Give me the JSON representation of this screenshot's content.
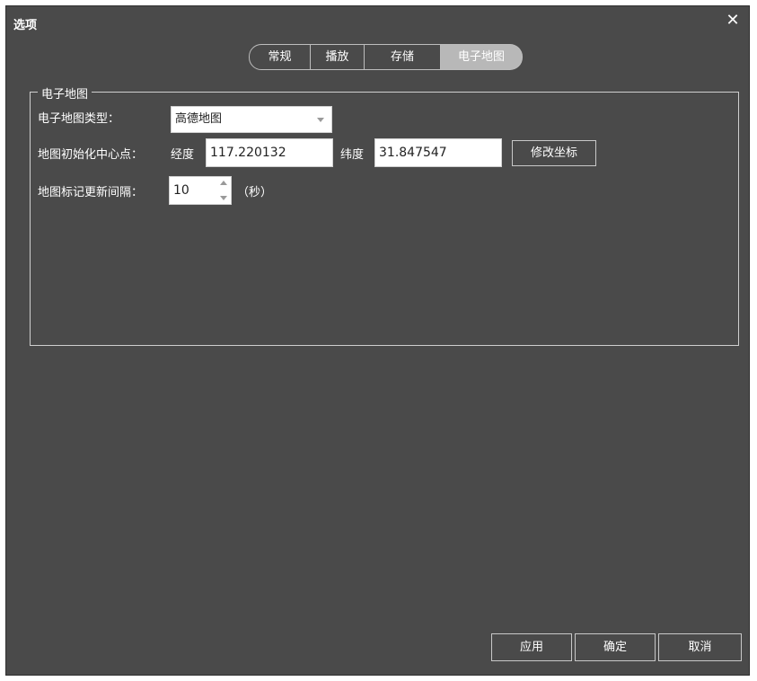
{
  "window": {
    "title": "选项",
    "close_glyph": "✕"
  },
  "tabs": [
    {
      "label": "常规",
      "active": false
    },
    {
      "label": "播放",
      "active": false
    },
    {
      "label": "存储",
      "active": false
    },
    {
      "label": "电子地图",
      "active": true
    }
  ],
  "group": {
    "legend": "电子地图",
    "map_type_label": "电子地图类型：",
    "map_type_value": "高德地图",
    "center_label": "地图初始化中心点：",
    "longitude_label": "经度",
    "longitude_value": "117.220132",
    "latitude_label": "纬度",
    "latitude_value": "31.847547",
    "modify_button": "修改坐标",
    "interval_label": "地图标记更新间隔：",
    "interval_value": "10",
    "interval_unit": "（秒）"
  },
  "footer": {
    "apply": "应用",
    "ok": "确定",
    "cancel": "取消"
  },
  "colors": {
    "background": "#4a4a4a",
    "tab_active": "#b8b8b8",
    "border": "#cfcfcf"
  }
}
